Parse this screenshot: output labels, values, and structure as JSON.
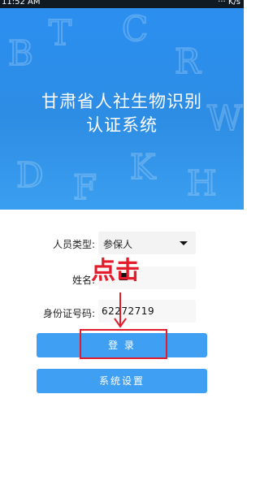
{
  "status_bar": {
    "time": "11:52 AM",
    "right": "··· K/s"
  },
  "header": {
    "title_line1": "甘肃省人社生物识别",
    "title_line2": "认证系统"
  },
  "form": {
    "person_type_label": "人员类型:",
    "person_type_value": "参保人",
    "name_label": "姓名:",
    "name_value": "",
    "id_label": "身份证号码:",
    "id_value": "62272719"
  },
  "buttons": {
    "login": "登 录",
    "settings": "系统设置"
  },
  "annotation": {
    "text": "点击",
    "color": "#e21c2a"
  },
  "colors": {
    "header": "#2d8de4",
    "button": "#3e9ff3"
  }
}
